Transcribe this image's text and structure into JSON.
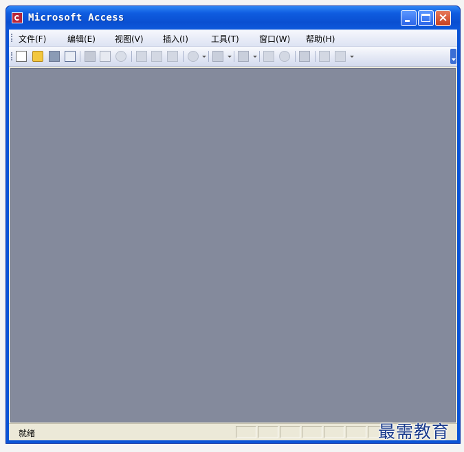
{
  "window": {
    "title": "Microsoft Access",
    "close_glyph": "×"
  },
  "menubar": {
    "items": [
      {
        "label": "文件(F)"
      },
      {
        "label": "编辑(E)"
      },
      {
        "label": "视图(V)"
      },
      {
        "label": "插入(I)"
      },
      {
        "label": "工具(T)"
      },
      {
        "label": "窗口(W)"
      },
      {
        "label": "帮助(H)"
      }
    ]
  },
  "toolbar": {
    "icons": [
      "new-icon",
      "open-icon",
      "save-icon",
      "file-search-icon",
      "print-icon",
      "print-preview-icon",
      "spelling-icon",
      "cut-icon",
      "copy-icon",
      "paste-icon",
      "undo-icon",
      "office-links-icon",
      "analyze-icon",
      "code-icon",
      "properties-icon",
      "relationships-icon",
      "new-object-icon"
    ]
  },
  "statusbar": {
    "text": "就绪"
  },
  "watermark": {
    "text": "最需教育"
  },
  "colors": {
    "titlebar": "#0a53d6",
    "workspace": "#848a9c",
    "accent": "#1a3b8c"
  }
}
